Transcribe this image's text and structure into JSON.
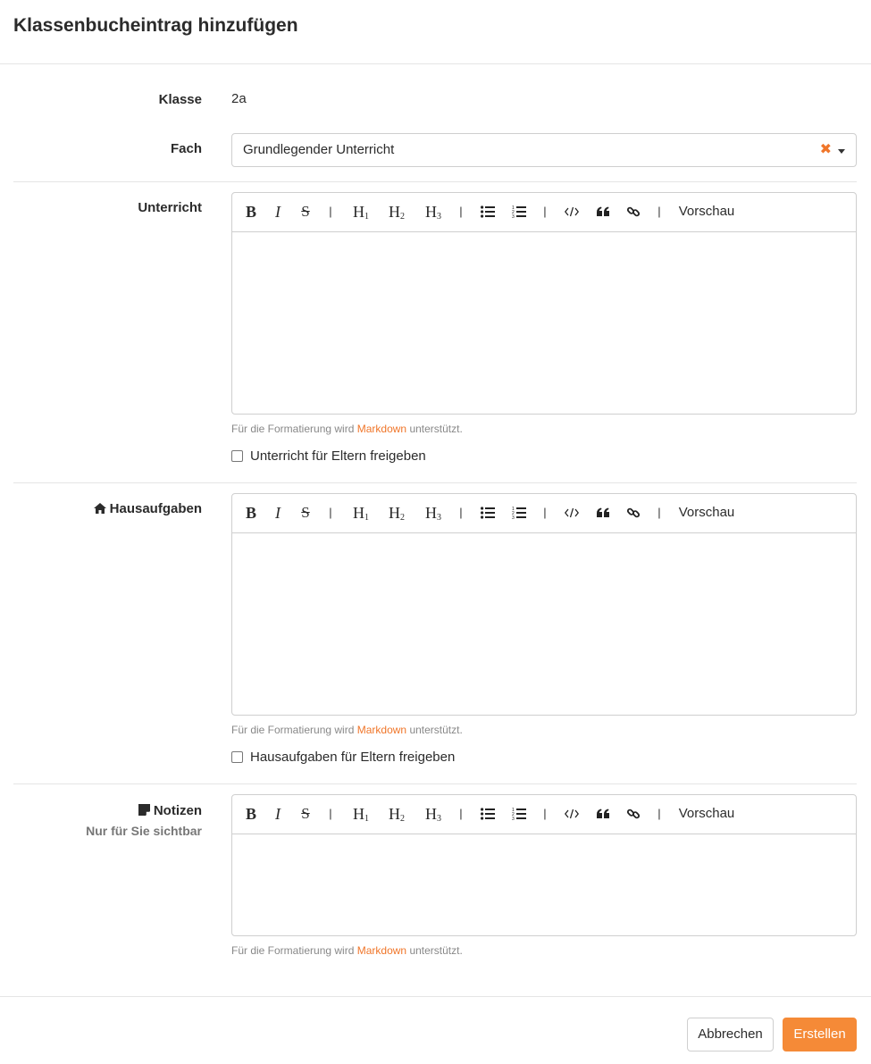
{
  "modal": {
    "title": "Klassenbucheintrag hinzufügen"
  },
  "fields": {
    "klasse": {
      "label": "Klasse",
      "value": "2a"
    },
    "fach": {
      "label": "Fach",
      "value": "Grundlegender Unterricht",
      "clear_glyph": "✖"
    },
    "unterricht": {
      "label": "Unterricht"
    },
    "hausaufgaben": {
      "label": "Hausaufgaben",
      "icon": "home-icon"
    },
    "notizen": {
      "label": "Notizen",
      "sublabel": "Nur für Sie sichtbar",
      "icon": "sticky-note-icon"
    }
  },
  "toolbar": {
    "bold": "B",
    "italic": "I",
    "strike": "S",
    "separator": "|",
    "h1": "H",
    "h1_sub": "1",
    "h2": "H",
    "h2_sub": "2",
    "h3": "H",
    "h3_sub": "3",
    "preview": "Vorschau"
  },
  "help": {
    "prefix": "Für die Formatierung wird",
    "link": "Markdown",
    "suffix": "unterstützt."
  },
  "checkboxes": {
    "unterricht_share": {
      "label": "Unterricht für Eltern freigeben",
      "checked": false
    },
    "hausaufgaben_share": {
      "label": "Hausaufgaben für Eltern freigeben",
      "checked": false
    }
  },
  "footer": {
    "cancel": "Abbrechen",
    "create": "Erstellen"
  },
  "colors": {
    "accent": "#f58a37",
    "link": "#f0762a"
  }
}
